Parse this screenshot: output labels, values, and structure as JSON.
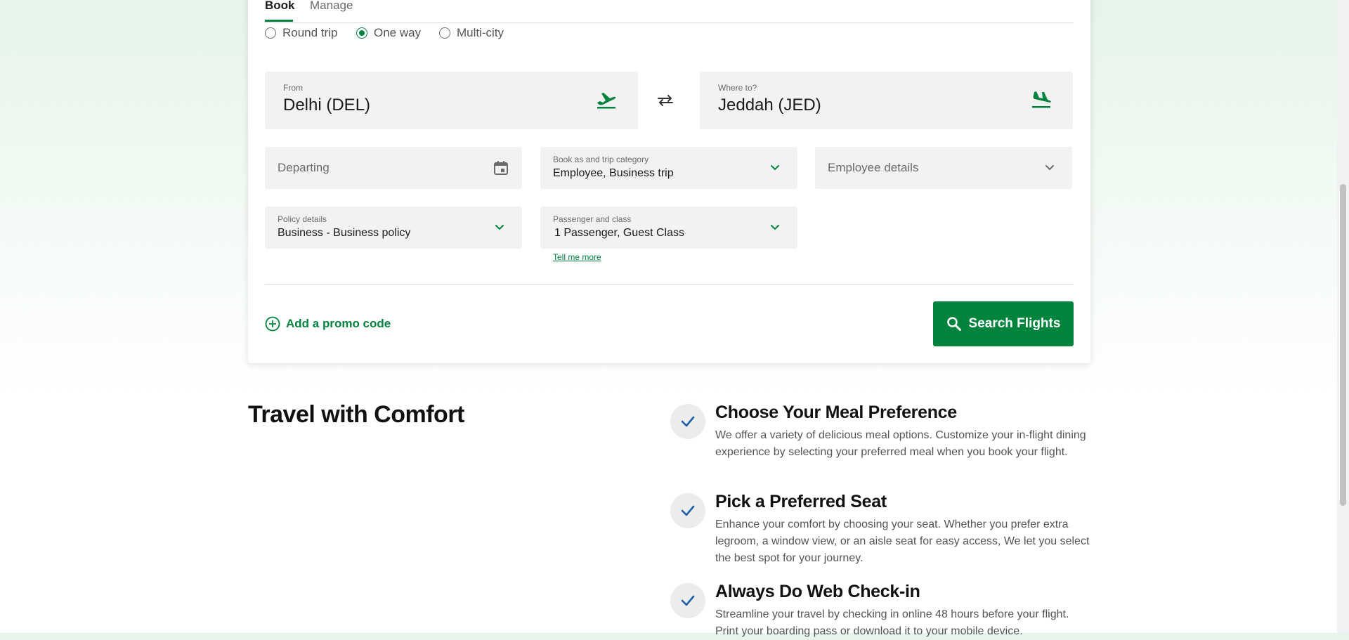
{
  "tabs": {
    "book": "Book",
    "manage": "Manage"
  },
  "trip_types": [
    "Round trip",
    "One way",
    "Multi-city"
  ],
  "selected_trip_type": "One way",
  "from": {
    "label": "From",
    "value": "Delhi (DEL)"
  },
  "to": {
    "label": "Where to?",
    "value": "Jeddah (JED)"
  },
  "departing": {
    "placeholder": "Departing"
  },
  "book_as": {
    "label": "Book as and trip category",
    "value": "Employee, Business trip"
  },
  "employee": {
    "placeholder": "Employee details"
  },
  "policy": {
    "label": "Policy details",
    "value": "Business - Business policy"
  },
  "passenger": {
    "label": "Passenger and class",
    "value": "1 Passenger, Guest Class",
    "link": "Tell me more"
  },
  "promo_label": "Add a promo code",
  "search_label": "Search Flights",
  "section_title": "Travel with Comfort",
  "features": [
    {
      "title": "Choose Your Meal Preference",
      "desc": "We offer a variety of delicious meal options. Customize your in-flight dining experience by selecting your preferred meal when you book your flight."
    },
    {
      "title": "Pick a Preferred Seat",
      "desc": "Enhance your comfort by choosing your seat. Whether you prefer extra legroom, a window view, or an aisle seat for easy access, We let you select the best spot for your journey."
    },
    {
      "title": "Always Do Web Check-in",
      "desc": "Streamline your travel by checking in online 48 hours before your flight. Print your boarding pass or download it to your mobile device."
    }
  ],
  "colors": {
    "accent": "#00843d",
    "check": "#1a5fa8"
  },
  "icons": {
    "from": "plane-takeoff-icon",
    "to": "plane-landing-icon",
    "swap": "swap-arrows-icon",
    "calendar": "calendar-icon",
    "chevron": "chevron-down-icon",
    "promo": "plus-circle-icon",
    "search": "search-icon",
    "check": "checkmark-icon"
  }
}
